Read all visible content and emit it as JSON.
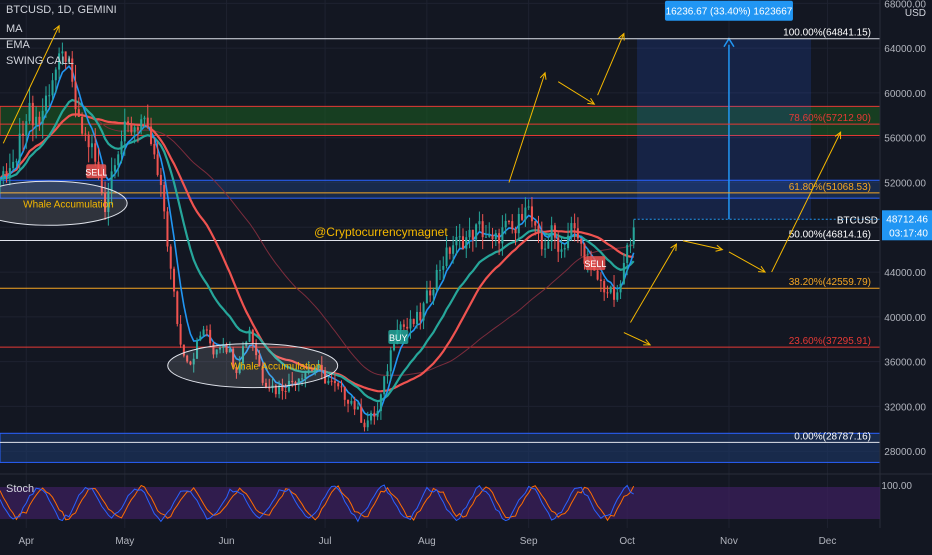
{
  "header": {
    "symbol_line": "BTCUSD, 1D, GEMINI",
    "indicators": [
      "MA",
      "EMA",
      "SWING CALL"
    ]
  },
  "currency": "USD",
  "watermark": "@Cryptocurrencymagnet",
  "colors": {
    "bg": "#131722",
    "grid": "#1e2230",
    "bull": "#26a69a",
    "bear": "#ef5350",
    "ma": "#ef5350",
    "ema_fast": "#2196f3",
    "ema_slow": "#26a69a",
    "arrow": "#f5b800",
    "fib_line": "#e0e3eb",
    "fib_red": "#e53935",
    "fib_orange": "#f5a623",
    "green_zone": "#1b5e20",
    "blue_zone": "#1e3a6e",
    "stoch_k": "#2962ff",
    "stoch_d": "#ff6d00",
    "stoch_band": "#3b1f5c",
    "price_tag": "#2196f3"
  },
  "chart_data": {
    "type": "candlestick",
    "y_axis": {
      "ticks": [
        28000,
        32000,
        36000,
        40000,
        44000,
        48000,
        52000,
        56000,
        60000,
        64000,
        68000
      ],
      "tick_labels": [
        "28000.00",
        "32000.00",
        "36000.00",
        "40000.00",
        "44000.00",
        "48000.00",
        "52000.00",
        "56000.00",
        "60000.00",
        "64000.00",
        "68000.00"
      ],
      "range": [
        26500,
        68300
      ]
    },
    "x_axis": {
      "labels": [
        "Apr",
        "May",
        "Jun",
        "Jul",
        "Aug",
        "Sep",
        "Oct",
        "Nov",
        "Dec"
      ],
      "label_days": [
        0,
        30,
        61,
        91,
        122,
        153,
        183,
        214,
        244
      ],
      "range_days": [
        -8,
        260
      ]
    },
    "price_path": [
      [
        -8,
        52000
      ],
      [
        -3,
        54000
      ],
      [
        0,
        58500
      ],
      [
        4,
        57500
      ],
      [
        8,
        61500
      ],
      [
        12,
        63500
      ],
      [
        13,
        62000
      ],
      [
        16,
        57000
      ],
      [
        20,
        55000
      ],
      [
        24,
        50000
      ],
      [
        27,
        54500
      ],
      [
        30,
        56500
      ],
      [
        35,
        57500
      ],
      [
        38,
        55500
      ],
      [
        42,
        49500
      ],
      [
        44,
        44000
      ],
      [
        47,
        37500
      ],
      [
        50,
        36000
      ],
      [
        54,
        39000
      ],
      [
        57,
        37000
      ],
      [
        60,
        38000
      ],
      [
        64,
        35500
      ],
      [
        68,
        39000
      ],
      [
        72,
        34500
      ],
      [
        76,
        33500
      ],
      [
        80,
        34000
      ],
      [
        84,
        35000
      ],
      [
        88,
        35500
      ],
      [
        91,
        34500
      ],
      [
        95,
        33500
      ],
      [
        99,
        32500
      ],
      [
        103,
        30500
      ],
      [
        107,
        31500
      ],
      [
        110,
        35500
      ],
      [
        113,
        39500
      ],
      [
        116,
        39000
      ],
      [
        120,
        40000
      ],
      [
        123,
        42500
      ],
      [
        126,
        44500
      ],
      [
        130,
        46500
      ],
      [
        134,
        47000
      ],
      [
        138,
        48000
      ],
      [
        142,
        46500
      ],
      [
        146,
        48000
      ],
      [
        149,
        47500
      ],
      [
        152,
        50500
      ],
      [
        155,
        47500
      ],
      [
        157,
        46000
      ],
      [
        160,
        47500
      ],
      [
        163,
        46000
      ],
      [
        166,
        48000
      ],
      [
        168,
        47000
      ],
      [
        172,
        44000
      ],
      [
        175,
        43000
      ],
      [
        178,
        42000
      ],
      [
        180,
        41500
      ],
      [
        182,
        44500
      ],
      [
        185,
        48700
      ]
    ],
    "current_price": 48712.46,
    "price_tag": {
      "symbol": "BTCUSD",
      "price": "48712.46",
      "countdown": "03:17:40"
    },
    "fib_levels": [
      {
        "label": "100.00%(64841.15)",
        "value": 64841.15
      },
      {
        "label": "78.60%(57212.90)",
        "value": 57212.9
      },
      {
        "label": "61.80%(51068.53)",
        "value": 51068.53
      },
      {
        "label": "50.00%(46814.16)",
        "value": 46814.16
      },
      {
        "label": "38.20%(42559.79)",
        "value": 42559.79
      },
      {
        "label": "23.60%(37295.91)",
        "value": 37295.91
      },
      {
        "label": "0.00%(28787.16)",
        "value": 28787.16
      }
    ],
    "zones": [
      {
        "kind": "supply",
        "from": 56200,
        "to": 58800
      },
      {
        "kind": "demand",
        "from": 50600,
        "to": 52200
      },
      {
        "kind": "demand",
        "from": 27000,
        "to": 29600
      }
    ],
    "measure": {
      "label": "16236.67 (33.40%) 1623667",
      "from": 48712.46,
      "to": 64841.15
    },
    "annotations": [
      {
        "text": "Whale Accumulation",
        "day": -4,
        "price": 50500
      },
      {
        "text": "Whale Accumulation",
        "day": 58,
        "price": 36000
      },
      {
        "text": "SELL",
        "day": 21,
        "price": 53000
      },
      {
        "text": "BUY",
        "day": 113,
        "price": 38200
      },
      {
        "text": "SELL",
        "day": 173,
        "price": 44800
      }
    ],
    "stochastic": {
      "label": "Stoch",
      "ticks": [
        100
      ],
      "tick_labels": [
        "100.00"
      ]
    }
  }
}
